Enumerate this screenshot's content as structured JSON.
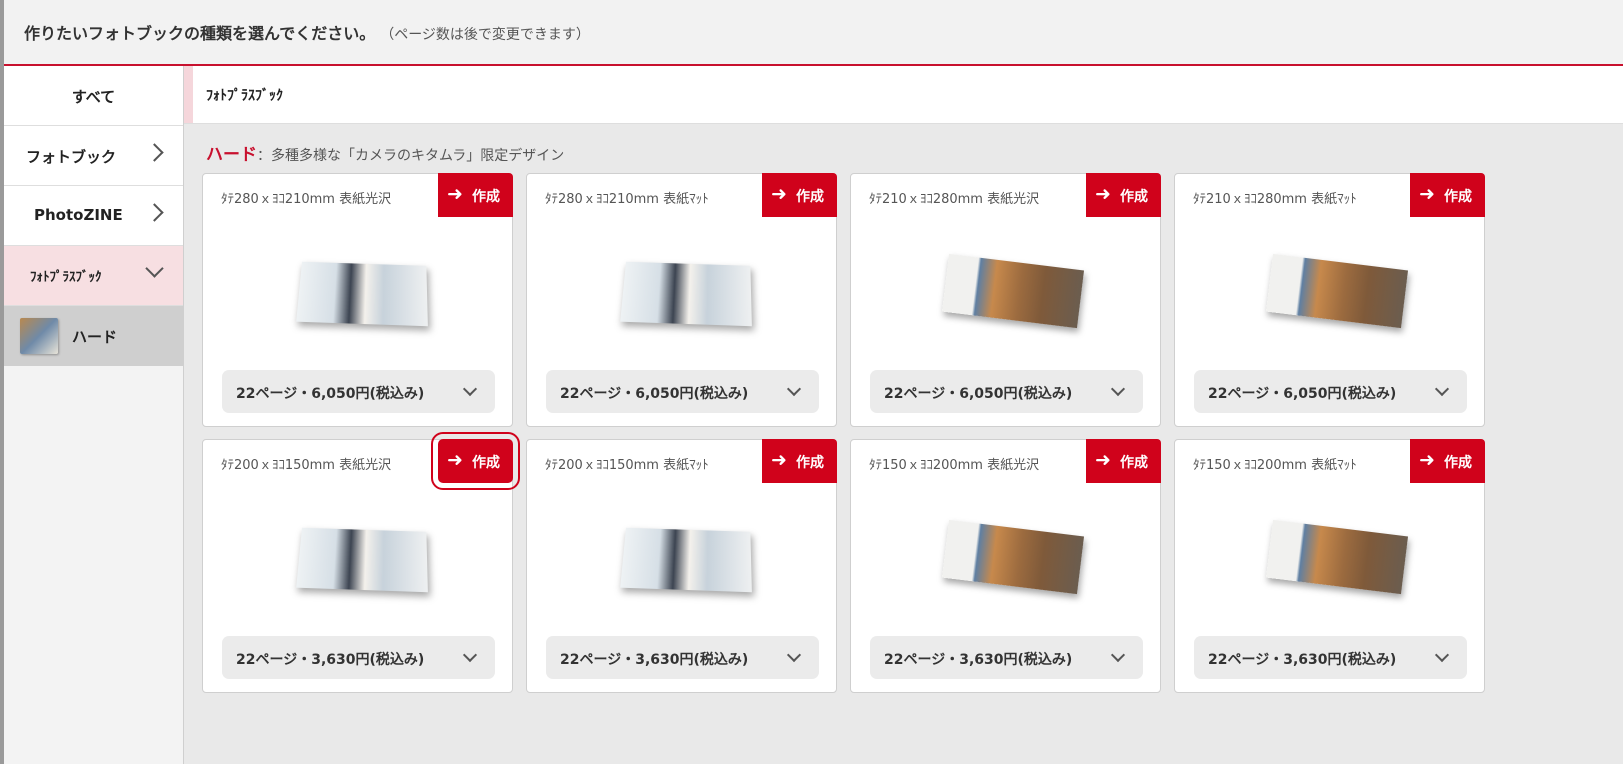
{
  "header": {
    "title": "作りたいフォトブックの種類を選んでください。",
    "note": "（ページ数は後で変更できます）"
  },
  "sidebar": {
    "items": [
      {
        "label": "すべて"
      },
      {
        "label": "フォトブック"
      },
      {
        "label": "PhotoZINE"
      },
      {
        "label": "ﾌｫﾄﾌﾟﾗｽﾌﾞｯｸ"
      },
      {
        "label": "ハード"
      }
    ]
  },
  "breadcrumb": {
    "text": "ﾌｫﾄﾌﾟﾗｽﾌﾞｯｸ"
  },
  "section": {
    "label": "ハード",
    "description": "：多種多様な「カメラのキタムラ」限定デザイン"
  },
  "create_label": "作成",
  "cards": [
    {
      "title": "ﾀﾃ280ｘﾖｺ210mm 表紙光沢",
      "price": "22ページ・6,050円(税込み)",
      "image": "wedding-photobook-landscape"
    },
    {
      "title": "ﾀﾃ280ｘﾖｺ210mm 表紙ﾏｯﾄ",
      "price": "22ページ・6,050円(税込み)",
      "image": "wedding-photobook-landscape"
    },
    {
      "title": "ﾀﾃ210ｘﾖｺ280mm 表紙光沢",
      "price": "22ページ・6,050円(税込み)",
      "image": "colosseum-photobook"
    },
    {
      "title": "ﾀﾃ210ｘﾖｺ280mm 表紙ﾏｯﾄ",
      "price": "22ページ・6,050円(税込み)",
      "image": "colosseum-photobook"
    },
    {
      "title": "ﾀﾃ200ｘﾖｺ150mm 表紙光沢",
      "price": "22ページ・3,630円(税込み)",
      "image": "wedding-photobook-landscape"
    },
    {
      "title": "ﾀﾃ200ｘﾖｺ150mm 表紙ﾏｯﾄ",
      "price": "22ページ・3,630円(税込み)",
      "image": "wedding-photobook-landscape"
    },
    {
      "title": "ﾀﾃ150ｘﾖｺ200mm 表紙光沢",
      "price": "22ページ・3,630円(税込み)",
      "image": "colosseum-photobook"
    },
    {
      "title": "ﾀﾃ150ｘﾖｺ200mm 表紙ﾏｯﾄ",
      "price": "22ページ・3,630円(税込み)",
      "image": "colosseum-photobook"
    }
  ],
  "colors": {
    "accent": "#d0021b",
    "active_bg": "#f7dfe2",
    "sub_bg": "#cfcfcf"
  },
  "icons": {
    "create": "arrow-right-icon",
    "dropdown": "chevron-down-icon",
    "nav": "chevron-right-icon"
  }
}
